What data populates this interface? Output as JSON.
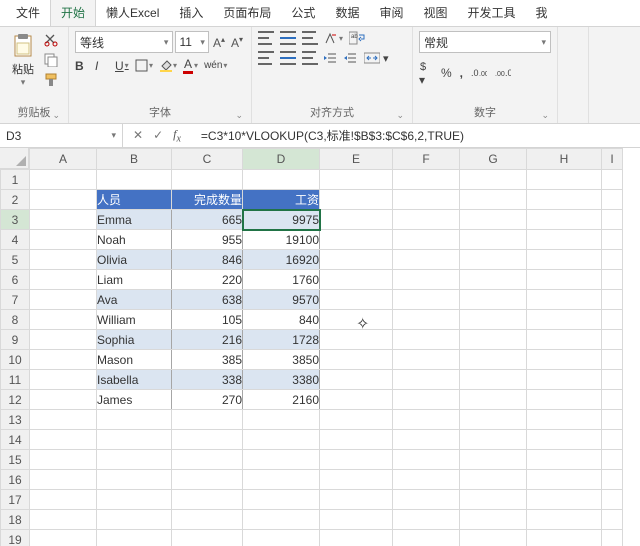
{
  "menubar": {
    "items": [
      "文件",
      "开始",
      "懒人Excel",
      "插入",
      "页面布局",
      "公式",
      "数据",
      "审阅",
      "视图",
      "开发工具",
      "我"
    ],
    "active_index": 1
  },
  "ribbon": {
    "clipboard": {
      "paste": "粘贴",
      "label": "剪贴板"
    },
    "font": {
      "name": "等线",
      "size": "11",
      "label": "字体",
      "wen": "wén"
    },
    "align": {
      "label": "对齐方式",
      "wrap": "ab"
    },
    "number": {
      "format": "常规",
      "label": "数字"
    }
  },
  "namebox": "D3",
  "formula": "=C3*10*VLOOKUP(C3,标准!$B$3:$C$6,2,TRUE)",
  "columns": [
    "A",
    "B",
    "C",
    "D",
    "E",
    "F",
    "G",
    "H",
    "I"
  ],
  "active": {
    "col": "D",
    "row": 3
  },
  "table": {
    "headers": [
      "人员",
      "完成数量",
      "工资"
    ],
    "rows": [
      {
        "name": "Emma",
        "qty": 665,
        "pay": 9975
      },
      {
        "name": "Noah",
        "qty": 955,
        "pay": 19100
      },
      {
        "name": "Olivia",
        "qty": 846,
        "pay": 16920
      },
      {
        "name": "Liam",
        "qty": 220,
        "pay": 1760
      },
      {
        "name": "Ava",
        "qty": 638,
        "pay": 9570
      },
      {
        "name": "William",
        "qty": 105,
        "pay": 840
      },
      {
        "name": "Sophia",
        "qty": 216,
        "pay": 1728
      },
      {
        "name": "Mason",
        "qty": 385,
        "pay": 3850
      },
      {
        "name": "Isabella",
        "qty": 338,
        "pay": 3380
      },
      {
        "name": "James",
        "qty": 270,
        "pay": 2160
      }
    ]
  },
  "total_rows": 19
}
